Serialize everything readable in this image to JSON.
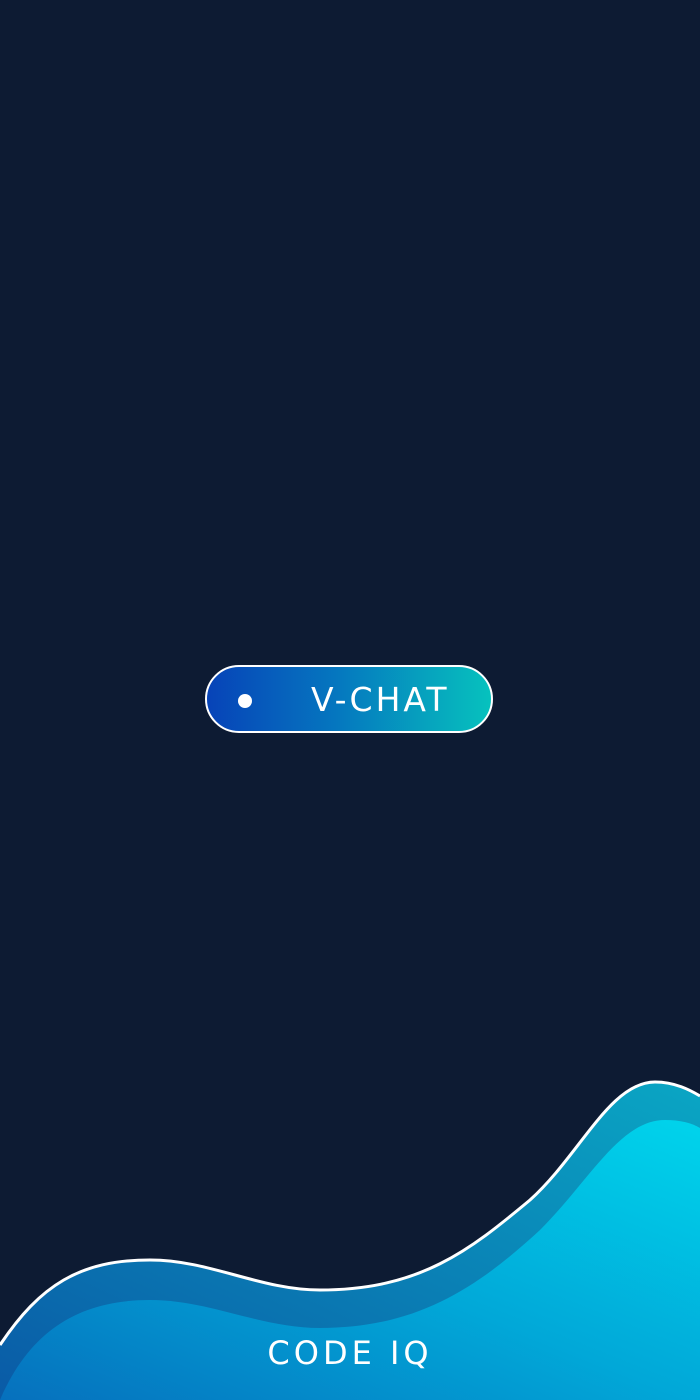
{
  "splash": {
    "app_name": "V-CHAT",
    "brand_name": "CODE IQ"
  },
  "icons": {
    "logo_dot": "dot-icon"
  },
  "colors": {
    "background": "#0d1b33",
    "pill_gradient_start": "#0743b8",
    "pill_gradient_end": "#06c2be",
    "pill_border": "#ffffff",
    "wave_light": "#00d0ec",
    "wave_dark": "#0669b4",
    "wave_outline": "#ffffff",
    "text": "#ffffff"
  }
}
